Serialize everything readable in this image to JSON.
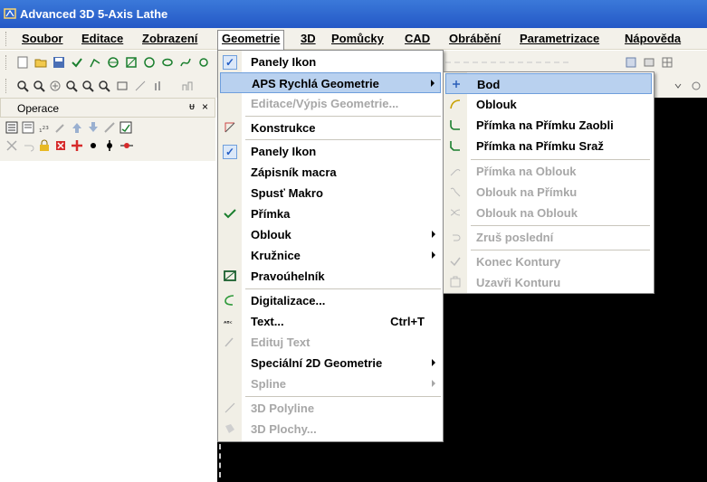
{
  "window": {
    "title": "Advanced 3D 5-Axis Lathe"
  },
  "menubar": [
    {
      "id": "soubor",
      "label": "Soubor"
    },
    {
      "id": "editace",
      "label": "Editace"
    },
    {
      "id": "zobrazeni",
      "label": "Zobrazení"
    },
    {
      "id": "geometrie",
      "label": "Geometrie",
      "active": true
    },
    {
      "id": "3d",
      "label": "3D"
    },
    {
      "id": "pomucky",
      "label": "Pomůcky"
    },
    {
      "id": "cad",
      "label": "CAD"
    },
    {
      "id": "obrabeni",
      "label": "Obrábění"
    },
    {
      "id": "parametrizace",
      "label": "Parametrizace"
    },
    {
      "id": "napoveda",
      "label": "Nápověda"
    }
  ],
  "panel": {
    "title": "Operace",
    "pin": "ᵾ",
    "close": "×"
  },
  "geometrie_menu": [
    {
      "label": "Panely Ikon",
      "checked": true
    },
    {
      "label": "APS Rychlá Geometrie",
      "submenu": true,
      "highlighted": true
    },
    {
      "label": "Editace/Výpis Geometrie...",
      "disabled": true
    },
    {
      "separator": true
    },
    {
      "label": "Konstrukce",
      "icon": "construction-icon"
    },
    {
      "separator": true
    },
    {
      "label": "Panely Ikon",
      "checked": true
    },
    {
      "label": "Zápisník macra"
    },
    {
      "label": "Spusť Makro"
    },
    {
      "label": "Přímka",
      "icon": "check-line-icon"
    },
    {
      "label": "Oblouk",
      "submenu": true
    },
    {
      "label": "Kružnice",
      "submenu": true
    },
    {
      "label": "Pravoúhelník",
      "icon": "rectangle-icon"
    },
    {
      "separator": true
    },
    {
      "label": "Digitalizace...",
      "icon": "digitize-icon"
    },
    {
      "label": "Text...",
      "shortcut": "Ctrl+T",
      "icon": "text-icon"
    },
    {
      "label": "Edituj Text",
      "disabled": true,
      "icon": "edit-text-icon"
    },
    {
      "label": "Speciální 2D Geometrie",
      "submenu": true
    },
    {
      "label": "Spline",
      "submenu": true,
      "disabled": true
    },
    {
      "separator": true
    },
    {
      "label": "3D Polyline",
      "disabled": true,
      "icon": "polyline-icon"
    },
    {
      "label": "3D Plochy...",
      "disabled": true,
      "icon": "surface-icon"
    }
  ],
  "submenu": [
    {
      "label": "Bod",
      "highlighted": true,
      "icon": "point-icon"
    },
    {
      "label": "Oblouk",
      "icon": "arc-icon"
    },
    {
      "label": "Přímka na Přímku Zaobli",
      "icon": "fillet-icon"
    },
    {
      "label": "Přímka na Přímku Sraž",
      "icon": "chamfer-icon"
    },
    {
      "separator": true
    },
    {
      "label": "Přímka na Oblouk",
      "disabled": true,
      "icon": "line-arc-icon"
    },
    {
      "label": "Oblouk na Přímku",
      "disabled": true,
      "icon": "arc-line-icon"
    },
    {
      "label": "Oblouk na Oblouk",
      "disabled": true,
      "icon": "arc-arc-icon"
    },
    {
      "separator": true
    },
    {
      "label": "Zruš poslední",
      "disabled": true,
      "icon": "undo-icon"
    },
    {
      "separator": true
    },
    {
      "label": "Konec Kontury",
      "disabled": true,
      "icon": "check-icon"
    },
    {
      "label": "Uzavři Konturu",
      "disabled": true,
      "icon": "close-contour-icon"
    }
  ],
  "colors": {
    "title_bar": "#2c62cf",
    "menu_highlight": "#b9d1ef",
    "canvas": "#000000"
  }
}
